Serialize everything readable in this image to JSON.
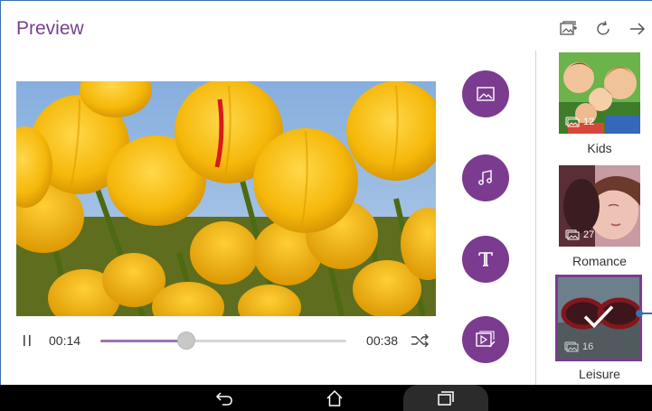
{
  "header": {
    "title": "Preview"
  },
  "player": {
    "current_time": "00:14",
    "duration": "00:38",
    "progress": 0.35
  },
  "actions": {
    "icons": [
      "gallery-add-icon",
      "refresh-icon",
      "arrow-right-icon"
    ]
  },
  "tools": {
    "icons": [
      "image-icon",
      "music-icon",
      "text-icon",
      "video-effect-icon"
    ]
  },
  "themes": [
    {
      "label": "Kids",
      "count": "12",
      "selected": false
    },
    {
      "label": "Romance",
      "count": "27",
      "selected": false
    },
    {
      "label": "Leisure",
      "count": "16",
      "selected": true
    }
  ],
  "colors": {
    "accent": "#7b3b8f",
    "title": "#7a3f8e",
    "navbar": "#000000"
  }
}
